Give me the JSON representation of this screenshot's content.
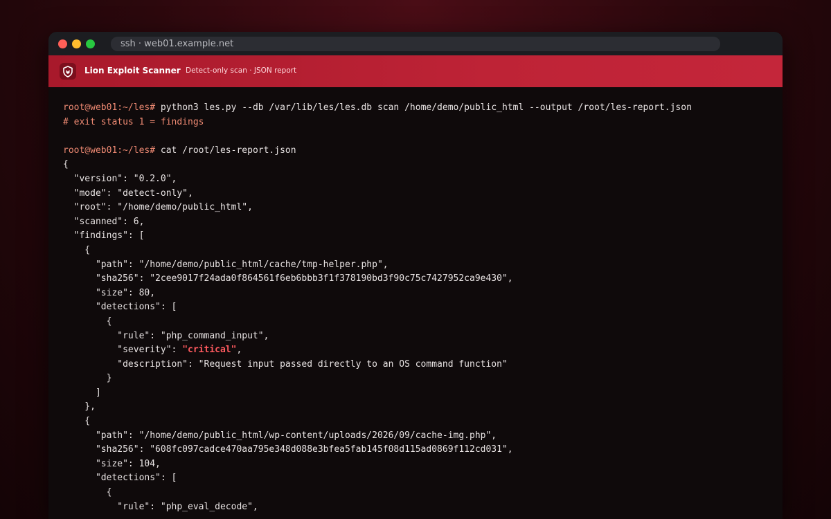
{
  "window": {
    "title": "ssh · web01.example.net"
  },
  "app": {
    "title": "Lion Exploit Scanner",
    "subtitle": "Detect-only scan · JSON report",
    "logo_icon": "shield-icon"
  },
  "colors": {
    "appbar": "#be2336",
    "prompt": "#ef8a73",
    "critical": "#ff5a5f",
    "terminal_bg": "#0f0a0b"
  },
  "terminal": {
    "prompt": "root@web01:~/les#",
    "command1": "python3 les.py --db /var/lib/les/les.db scan /home/demo/public_html --output /root/les-report.json",
    "comment": "# exit status 1 = findings",
    "command2": "cat /root/les-report.json",
    "json_lines": [
      "{",
      "  \"version\": \"0.2.0\",",
      "  \"mode\": \"detect-only\",",
      "  \"root\": \"/home/demo/public_html\",",
      "  \"scanned\": 6,",
      "  \"findings\": [",
      "    {",
      "      \"path\": \"/home/demo/public_html/cache/tmp-helper.php\",",
      "      \"sha256\": \"2cee9017f24ada0f864561f6eb6bbb3f1f378190bd3f90c75c7427952ca9e430\",",
      "      \"size\": 80,",
      "      \"detections\": [",
      "        {",
      "          \"rule\": \"php_command_input\","
    ],
    "severity_prefix": "          \"severity\": ",
    "severity_value": "\"critical\"",
    "severity_suffix": ",",
    "json_lines_2": [
      "          \"description\": \"Request input passed directly to an OS command function\"",
      "        }",
      "      ]",
      "    },",
      "    {",
      "      \"path\": \"/home/demo/public_html/wp-content/uploads/2026/09/cache-img.php\",",
      "      \"sha256\": \"608fc097cadce470aa795e348d088e3bfea5fab145f08d115ad0869f112cd031\",",
      "      \"size\": 104,",
      "      \"detections\": [",
      "        {",
      "          \"rule\": \"php_eval_decode\","
    ]
  }
}
